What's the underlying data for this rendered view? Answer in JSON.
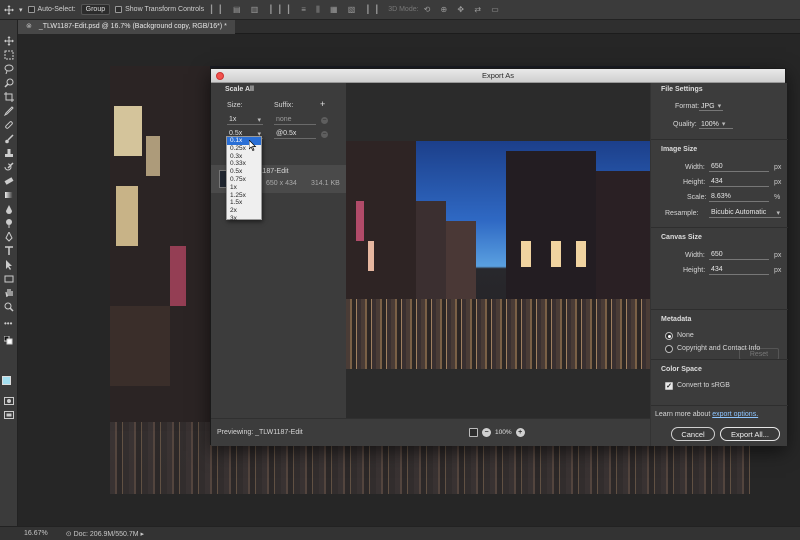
{
  "options_bar": {
    "auto_select_label": "Auto-Select:",
    "auto_select_target": "Group",
    "transform_controls_label": "Show Transform Controls",
    "mode_3d_label": "3D Mode:"
  },
  "document_tab": {
    "close_glyph": "⊗",
    "title": "_TLW1187-Edit.psd @ 16.7% (Background copy, RGB/16*) *"
  },
  "status_bar": {
    "zoom": "16.67%",
    "doc_info": "Doc: 206.9M/550.7M"
  },
  "dialog": {
    "title": "Export As",
    "left": {
      "scale_all_heading": "Scale All",
      "size_label": "Size:",
      "suffix_label": "Suffix:",
      "add_glyph": "+",
      "row1_size": "1x",
      "row1_suffix_placeholder": "none",
      "row2_size": "0.5x",
      "row2_suffix": "@0.5x",
      "asset_name": "_TLW1187-Edit",
      "asset_dims": "650 x 434",
      "asset_filesize": "314.1 KB"
    },
    "size_dropdown": {
      "options": [
        "0.1x",
        "0.25x",
        "0.3x",
        "0.33x",
        "0.5x",
        "0.75x",
        "1x",
        "1.25x",
        "1.5x",
        "2x",
        "3x"
      ],
      "selected": "0.1x"
    },
    "preview": {
      "previewing_label": "Previewing: _TLW1187-Edit",
      "zoom_out_glyph": "−",
      "zoom_level": "100%",
      "zoom_in_glyph": "+"
    },
    "right": {
      "file_settings_heading": "File Settings",
      "format_label": "Format:",
      "format_value": "JPG",
      "quality_label": "Quality:",
      "quality_value": "100%",
      "image_size_heading": "Image Size",
      "width_label": "Width:",
      "width_value": "650",
      "height_label": "Height:",
      "height_value": "434",
      "scale_label": "Scale:",
      "scale_value": "8.63%",
      "resample_label": "Resample:",
      "resample_value": "Bicubic Automatic",
      "unit_px": "px",
      "unit_pct": "%",
      "canvas_size_heading": "Canvas Size",
      "canvas_width_value": "650",
      "canvas_height_value": "434",
      "reset_label": "Reset",
      "metadata_heading": "Metadata",
      "metadata_none": "None",
      "metadata_copyright": "Copyright and Contact Info",
      "color_space_heading": "Color Space",
      "convert_srgb": "Convert to sRGB",
      "learn_more_prefix": "Learn more about",
      "learn_more_link": "export options."
    },
    "buttons": {
      "cancel": "Cancel",
      "export_all": "Export All..."
    }
  },
  "colors": {
    "foreground_swatch": "#a4dff0",
    "background_swatch": "#5ab5d8",
    "dropdown_highlight": "#2a6fd6",
    "close_button": "#f2524d"
  },
  "icons": [
    "move-icon",
    "marquee-icon",
    "lasso-icon",
    "quick-select-icon",
    "crop-icon",
    "eyedropper-icon",
    "healing-icon",
    "brush-icon",
    "stamp-icon",
    "history-brush-icon",
    "eraser-icon",
    "gradient-icon",
    "blur-icon",
    "dodge-icon",
    "pen-icon",
    "type-icon",
    "path-select-icon",
    "rectangle-icon",
    "hand-icon",
    "zoom-icon",
    "more-tools-icon",
    "quick-mask-icon",
    "screen-mode-icon"
  ]
}
